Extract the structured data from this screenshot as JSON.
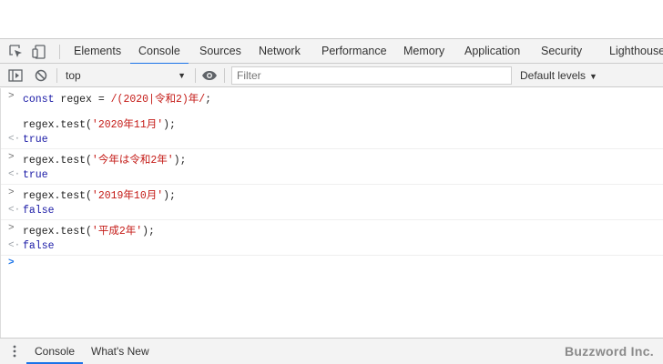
{
  "devtools": {
    "tabs": [
      {
        "label": "Elements"
      },
      {
        "label": "Console"
      },
      {
        "label": "Sources"
      },
      {
        "label": "Network"
      },
      {
        "label": "Performance"
      },
      {
        "label": "Memory"
      },
      {
        "label": "Application"
      },
      {
        "label": "Security"
      },
      {
        "label": "Lighthouse"
      }
    ],
    "active_tab": "Console",
    "accent_color": "#1a73e8"
  },
  "toolbar": {
    "context": "top",
    "filter_placeholder": "Filter",
    "levels_label": "Default levels"
  },
  "console": {
    "lines": [
      {
        "type": "input",
        "code": "const regex = /(2020|令和2)年/;"
      },
      {
        "type": "input",
        "code": "regex.test('2020年11月');"
      },
      {
        "type": "result",
        "value": "true"
      },
      {
        "type": "input",
        "code": "regex.test('今年は令和2年');"
      },
      {
        "type": "result",
        "value": "true"
      },
      {
        "type": "input",
        "code": "regex.test('2019年10月');"
      },
      {
        "type": "result",
        "value": "false"
      },
      {
        "type": "input",
        "code": "regex.test('平成2年');"
      },
      {
        "type": "result",
        "value": "false"
      }
    ]
  },
  "drawer": {
    "tabs": [
      {
        "label": "Console"
      },
      {
        "label": "What's New"
      }
    ],
    "watermark": "Buzzword Inc."
  }
}
